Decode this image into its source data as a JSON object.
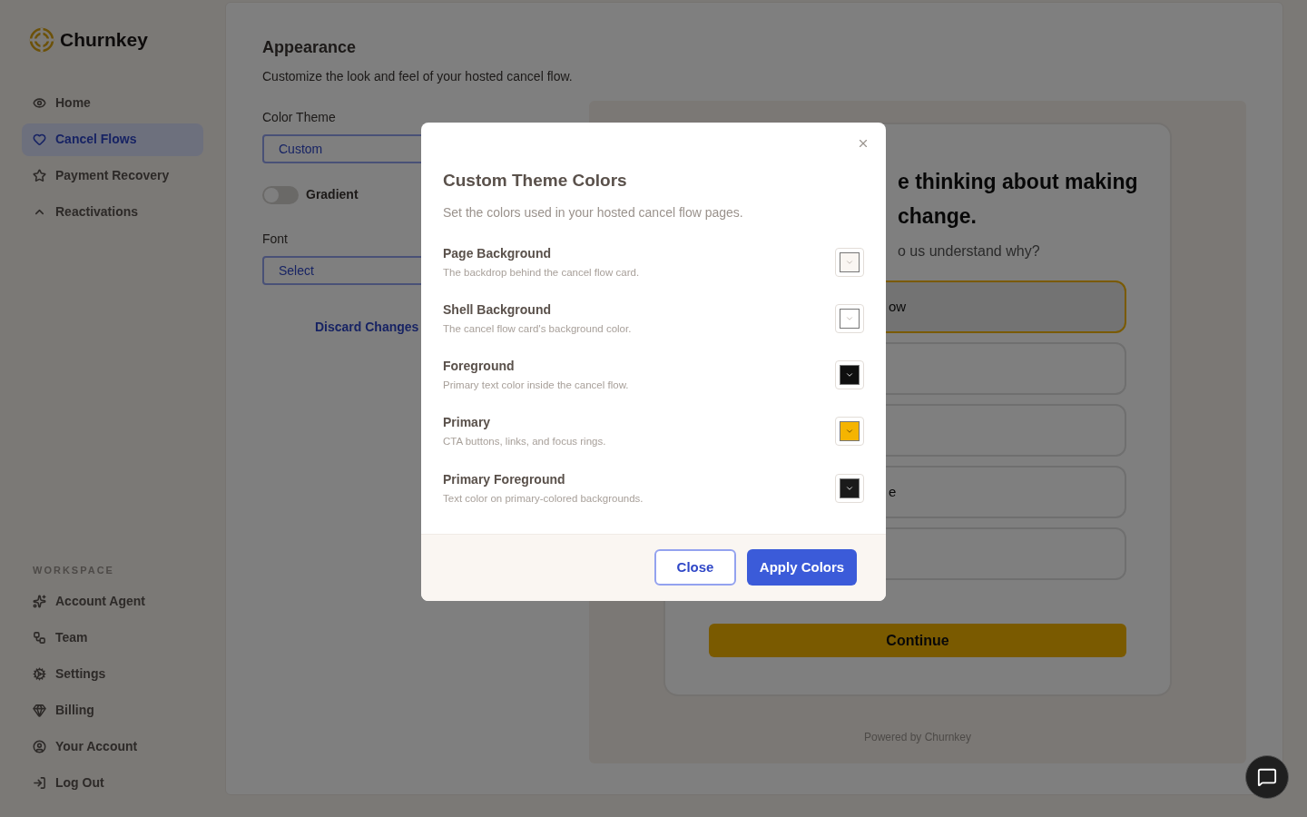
{
  "sidebar": {
    "brand": "Churnkey",
    "items": [
      {
        "label": "Home",
        "selected": false
      },
      {
        "label": "Cancel Flows",
        "selected": true
      },
      {
        "label": "Payment Recovery",
        "selected": false
      },
      {
        "label": "Reactivations",
        "selected": false
      }
    ],
    "section_label": "WORKSPACE",
    "workspace_items": [
      {
        "label": "Account Agent",
        "selected": false
      },
      {
        "label": "Team",
        "selected": false
      },
      {
        "label": "Settings",
        "selected": false
      },
      {
        "label": "Billing",
        "selected": false
      },
      {
        "label": "Your Account",
        "selected": false
      },
      {
        "label": "Log Out",
        "selected": false
      }
    ]
  },
  "main": {
    "title": "Appearance",
    "subtitle": "Customize the look and feel of your hosted cancel flow.",
    "color_theme": {
      "label": "Color Theme",
      "value": "Custom"
    },
    "gradient": {
      "label": "Gradient",
      "on": false
    },
    "font": {
      "label": "Font",
      "value": "Select"
    },
    "discard": "Discard Changes"
  },
  "preview": {
    "heading_lines": [
      "e thinking about making",
      "change."
    ],
    "question": "o us understand why?",
    "options": [
      {
        "label": "ow",
        "selected": true
      },
      {
        "selected": false
      },
      {
        "selected": false
      },
      {
        "label": "e",
        "selected": false
      },
      {
        "selected": false
      }
    ],
    "continue": "Continue",
    "footer": "Powered by Churnkey"
  },
  "dialog": {
    "title": "Custom Theme Colors",
    "subtitle": "Set the colors used in your hosted cancel flow pages.",
    "colors": [
      {
        "label": "Page Background",
        "description": "The backdrop behind the cancel flow card.",
        "color": "#faf6f2"
      },
      {
        "label": "Shell Background",
        "description": "The cancel flow card's background color.",
        "color": "#ffffff"
      },
      {
        "label": "Foreground",
        "description": "Primary text color inside the cancel flow.",
        "color": "#0f0f0f"
      },
      {
        "label": "Primary",
        "description": "CTA buttons, links, and focus rings.",
        "color": "#f5b400"
      },
      {
        "label": "Primary Foreground",
        "description": "Text color on primary-colored backgrounds.",
        "color": "#1a1a1a"
      }
    ],
    "close": "Close",
    "apply": "Apply Colors"
  }
}
